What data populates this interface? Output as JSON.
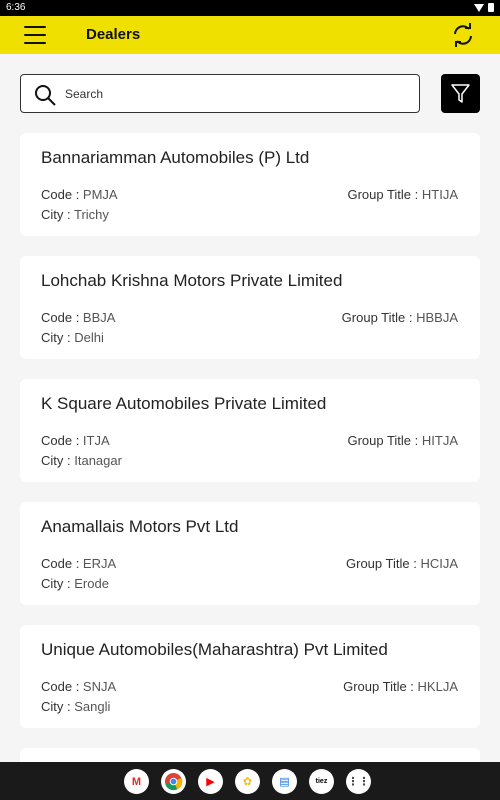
{
  "status": {
    "time": "6:36"
  },
  "header": {
    "title": "Dealers"
  },
  "search": {
    "placeholder": "Search"
  },
  "dealers": [
    {
      "name": "Bannariamman Automobiles (P) Ltd",
      "code_label": "Code : ",
      "code": "PMJA",
      "city_label": "City : ",
      "city": "Trichy",
      "group_label": "Group Title : ",
      "group": "HTIJA"
    },
    {
      "name": "Lohchab Krishna Motors Private Limited",
      "code_label": "Code : ",
      "code": "BBJA",
      "city_label": "City : ",
      "city": "Delhi",
      "group_label": "Group Title : ",
      "group": "HBBJA"
    },
    {
      "name": "K Square Automobiles Private Limited",
      "code_label": "Code : ",
      "code": "ITJA",
      "city_label": "City : ",
      "city": "Itanagar",
      "group_label": "Group Title : ",
      "group": "HITJA"
    },
    {
      "name": "Anamallais Motors Pvt Ltd",
      "code_label": "Code : ",
      "code": "ERJA",
      "city_label": "City : ",
      "city": "Erode",
      "group_label": "Group Title : ",
      "group": "HCIJA"
    },
    {
      "name": "Unique Automobiles(Maharashtra) Pvt Limited",
      "code_label": "Code : ",
      "code": "SNJA",
      "city_label": "City : ",
      "city": "Sangli",
      "group_label": "Group Title : ",
      "group": "HKLJA"
    }
  ],
  "dock": {
    "apps": [
      {
        "name": "gmail-icon",
        "glyph": "M",
        "color": "#d93025"
      },
      {
        "name": "chrome-icon",
        "glyph": "",
        "color": "#4285f4"
      },
      {
        "name": "youtube-icon",
        "glyph": "▶",
        "color": "#ff0000"
      },
      {
        "name": "photos-icon",
        "glyph": "✿",
        "color": "#fbbc04"
      },
      {
        "name": "messages-icon",
        "glyph": "▤",
        "color": "#1a73e8"
      },
      {
        "name": "tiez-icon",
        "glyph": "tiez",
        "color": "#000000"
      },
      {
        "name": "app-drawer-icon",
        "glyph": "⋮⋮",
        "color": "#444444"
      }
    ]
  },
  "colors": {
    "app_bar": "#f0e000",
    "filter_button": "#000000",
    "card_bg": "#ffffff",
    "page_bg": "#f5f5f5"
  }
}
